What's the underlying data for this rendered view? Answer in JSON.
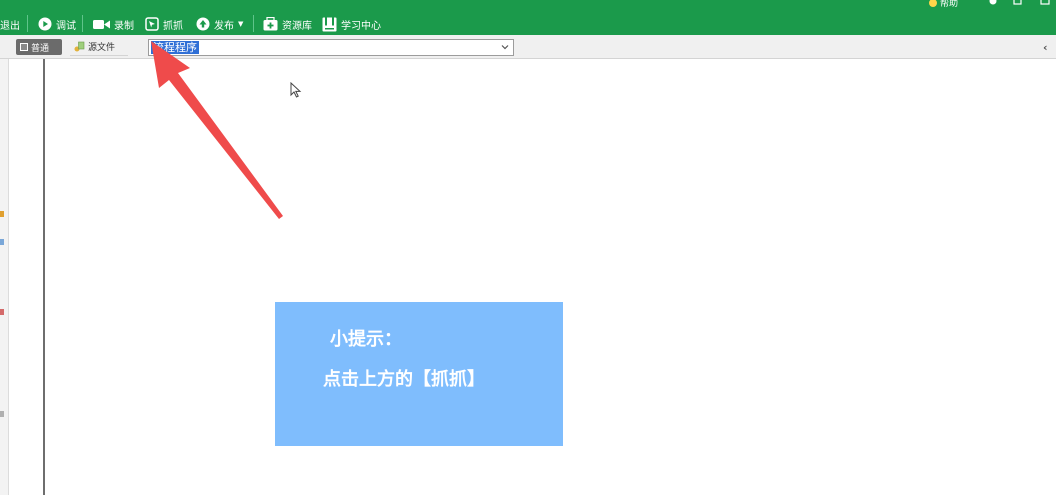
{
  "toolbar": {
    "items": [
      {
        "label": "退出",
        "icon": "exit-icon"
      },
      {
        "label": "调试",
        "icon": "play-icon"
      },
      {
        "label": "录制",
        "icon": "video-camera-icon"
      },
      {
        "label": "抓抓",
        "icon": "capture-icon"
      },
      {
        "label": "发布",
        "icon": "publish-icon"
      },
      {
        "label": "资源库",
        "icon": "resource-library-icon"
      },
      {
        "label": "学习中心",
        "icon": "learning-center-icon"
      }
    ],
    "top_right_label": "帮助"
  },
  "tabs": {
    "normal_label": "普通",
    "source_label": "源文件"
  },
  "combo": {
    "value": "流程程序"
  },
  "tip": {
    "title": "小提示：",
    "body": "点击上方的【抓抓】"
  },
  "colors": {
    "toolbar_bg": "#1b9a4b",
    "tip_bg": "#7fbdfd",
    "arrow": "#ef4b4b",
    "selection": "#2f6fd6"
  }
}
